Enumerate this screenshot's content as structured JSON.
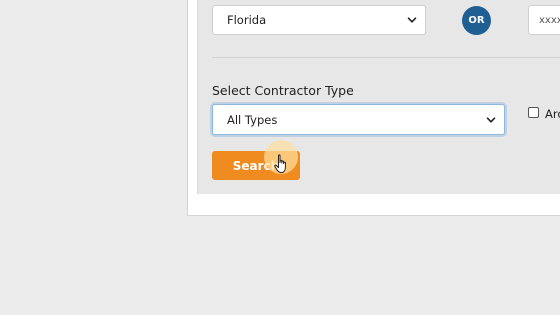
{
  "filters": {
    "state_select": {
      "value": "Florida"
    },
    "or_badge": "OR",
    "license_input": {
      "value": "xxxx"
    },
    "contractor_type": {
      "label": "Select Contractor Type",
      "value": "All Types"
    },
    "checkbox": {
      "label": "Arc",
      "checked": false
    },
    "search_button": "Search"
  },
  "colors": {
    "accent_orange": "#f08c1f",
    "badge_blue": "#1f5f94"
  },
  "icons": {
    "dropdown": "chevron-down-icon",
    "cursor": "hand-pointer-icon"
  }
}
